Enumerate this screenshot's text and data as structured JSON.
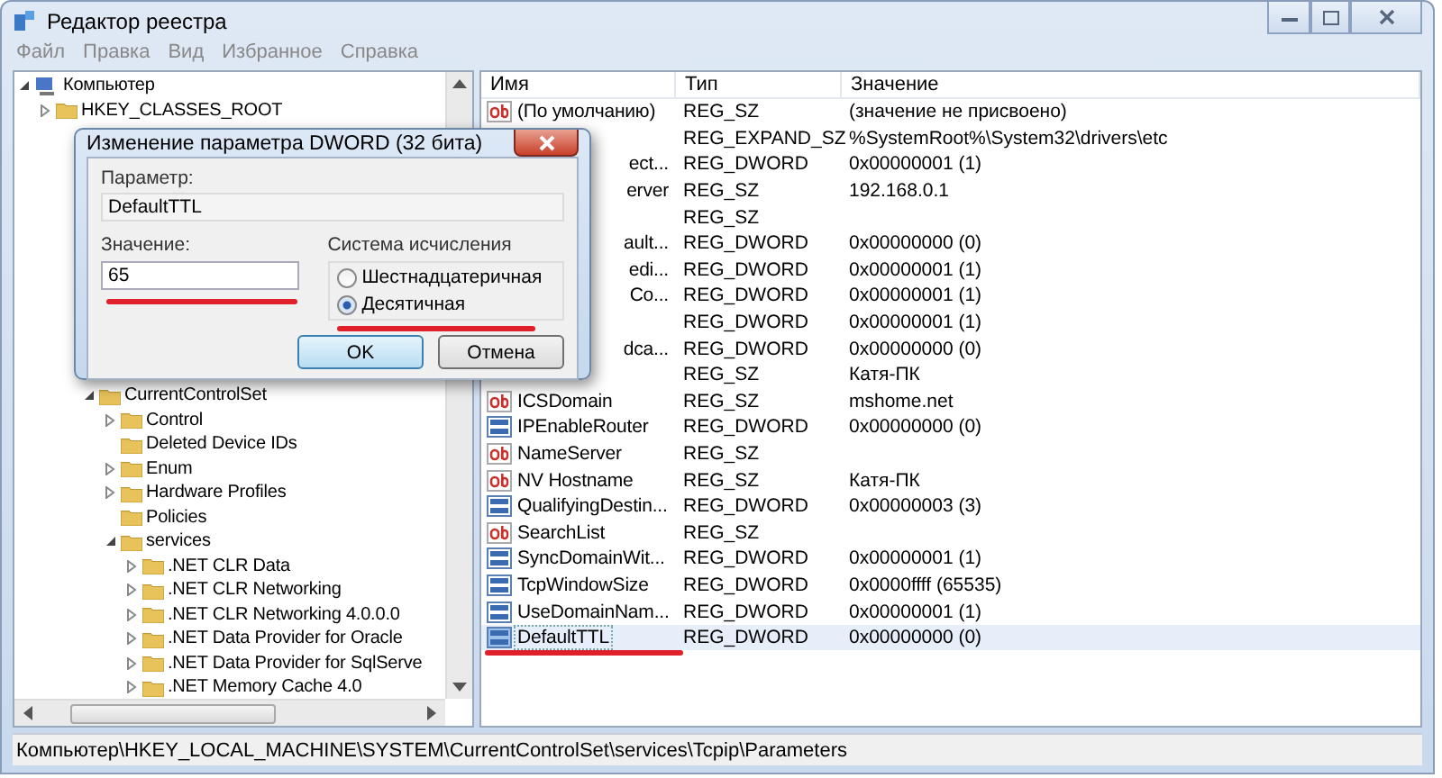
{
  "window": {
    "title": "Редактор реестра"
  },
  "menu": [
    "Файл",
    "Правка",
    "Вид",
    "Избранное",
    "Справка"
  ],
  "tree": {
    "label": "Компьютер",
    "expanded": true,
    "children": [
      {
        "label": "HKEY_CLASSES_ROOT",
        "expanded": false
      },
      {
        "label": "CurrentControlSet",
        "expanded": true,
        "children": [
          {
            "label": "Control",
            "expanded": false
          },
          {
            "label": "Deleted Device IDs"
          },
          {
            "label": "Enum",
            "expanded": false
          },
          {
            "label": "Hardware Profiles",
            "expanded": false
          },
          {
            "label": "Policies"
          },
          {
            "label": "services",
            "expanded": true,
            "children": [
              {
                "label": ".NET CLR Data",
                "expanded": false
              },
              {
                "label": ".NET CLR Networking",
                "expanded": false
              },
              {
                "label": ".NET CLR Networking 4.0.0.0",
                "expanded": false
              },
              {
                "label": ".NET Data Provider for Oracle",
                "expanded": false
              },
              {
                "label": ".NET Data Provider for SqlServe",
                "expanded": false
              },
              {
                "label": ".NET Memory Cache 4.0",
                "expanded": false
              }
            ]
          }
        ]
      }
    ]
  },
  "table": {
    "columns": [
      "Имя",
      "Тип",
      "Значение"
    ],
    "rows": [
      {
        "kind": "text",
        "name": "(По умолчанию)",
        "type": "REG_SZ",
        "value": "(значение не присвоено)",
        "selected": false
      },
      {
        "kind": "covered",
        "type": "REG_EXPAND_SZ",
        "value": "%SystemRoot%\\System32\\drivers\\etc",
        "selected": false
      },
      {
        "kind": "covered",
        "name": "ect...",
        "type": "REG_DWORD",
        "value": "0x00000001 (1)",
        "selected": false
      },
      {
        "kind": "covered",
        "name": "erver",
        "type": "REG_SZ",
        "value": "192.168.0.1",
        "selected": false
      },
      {
        "kind": "covered",
        "type": "REG_SZ",
        "selected": false
      },
      {
        "kind": "covered",
        "name": "ault...",
        "type": "REG_DWORD",
        "value": "0x00000000 (0)",
        "selected": false
      },
      {
        "kind": "covered",
        "name": "edi...",
        "type": "REG_DWORD",
        "value": "0x00000001 (1)",
        "selected": false
      },
      {
        "kind": "covered",
        "name": "Co...",
        "type": "REG_DWORD",
        "value": "0x00000001 (1)",
        "selected": false
      },
      {
        "kind": "covered",
        "type": "REG_DWORD",
        "value": "0x00000001 (1)",
        "selected": false
      },
      {
        "kind": "covered",
        "name": "dca...",
        "type": "REG_DWORD",
        "value": "0x00000000 (0)",
        "selected": false
      },
      {
        "kind": "covered",
        "type": "REG_SZ",
        "value": "Катя-ПК",
        "selected": false
      },
      {
        "kind": "text",
        "name": "ICSDomain",
        "type": "REG_SZ",
        "value": "mshome.net",
        "selected": false
      },
      {
        "kind": "number",
        "name": "IPEnableRouter",
        "type": "REG_DWORD",
        "value": "0x00000000 (0)",
        "selected": false
      },
      {
        "kind": "text",
        "name": "NameServer",
        "type": "REG_SZ",
        "selected": false
      },
      {
        "kind": "text",
        "name": "NV Hostname",
        "type": "REG_SZ",
        "value": "Катя-ПК",
        "selected": false
      },
      {
        "kind": "number",
        "name": "QualifyingDestin...",
        "type": "REG_DWORD",
        "value": "0x00000003 (3)",
        "selected": false
      },
      {
        "kind": "text",
        "name": "SearchList",
        "type": "REG_SZ",
        "selected": false
      },
      {
        "kind": "number",
        "name": "SyncDomainWit...",
        "type": "REG_DWORD",
        "value": "0x00000001 (1)",
        "selected": false
      },
      {
        "kind": "number",
        "name": "TcpWindowSize",
        "type": "REG_DWORD",
        "value": "0x0000ffff (65535)",
        "selected": false
      },
      {
        "kind": "number",
        "name": "UseDomainNam...",
        "type": "REG_DWORD",
        "value": "0x00000001 (1)",
        "selected": false
      },
      {
        "kind": "number",
        "name": "DefaultTTL",
        "type": "REG_DWORD",
        "value": "0x00000000 (0)",
        "selected": true
      }
    ]
  },
  "status_bar": "Компьютер\\HKEY_LOCAL_MACHINE\\SYSTEM\\CurrentControlSet\\services\\Tcpip\\Parameters",
  "dialog": {
    "title": "Изменение параметра DWORD (32 бита)",
    "name_label": "Параметр:",
    "name_value": "DefaultTTL",
    "value_label": "Значение:",
    "value": "65",
    "base_label": "Система исчисления",
    "bases": [
      {
        "label": "Шестнадцатеричная",
        "selected": false
      },
      {
        "label": "Десятичная",
        "selected": true
      }
    ],
    "buttons": [
      {
        "label": "OK",
        "default": true
      },
      {
        "label": "Отмена",
        "default": false
      }
    ]
  }
}
